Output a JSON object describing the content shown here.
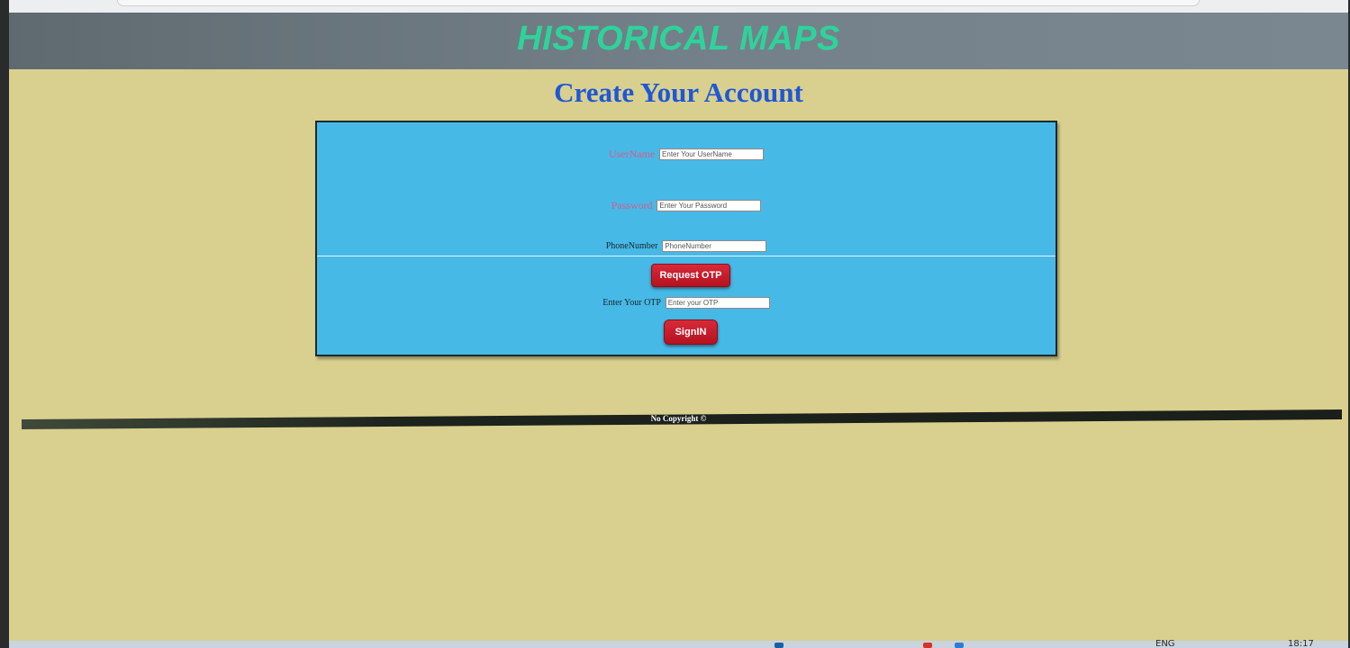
{
  "header": {
    "site_title": "HISTORICAL MAPS"
  },
  "page": {
    "heading": "Create Your Account"
  },
  "form": {
    "username_label": "UserName",
    "username_placeholder": "Enter Your UserName",
    "password_label": "Password",
    "password_placeholder": "Enter Your Password",
    "phone_label": "PhoneNumber",
    "phone_placeholder": "PhoneNumber",
    "request_otp_label": "Request OTP",
    "otp_label": "Enter Your OTP",
    "otp_placeholder": "Enter your OTP",
    "signin_label": "SignIN"
  },
  "footer": {
    "text": "No Copyright ©"
  },
  "taskbar": {
    "language": "ENG",
    "clock": "18:17"
  },
  "colors": {
    "page_background": "#d9d08f",
    "header_background": "#748089",
    "title_color": "#2ed39a",
    "heading_color": "#1f57d6",
    "panel_background": "#47b9e7",
    "button_color": "#c41d2b"
  }
}
